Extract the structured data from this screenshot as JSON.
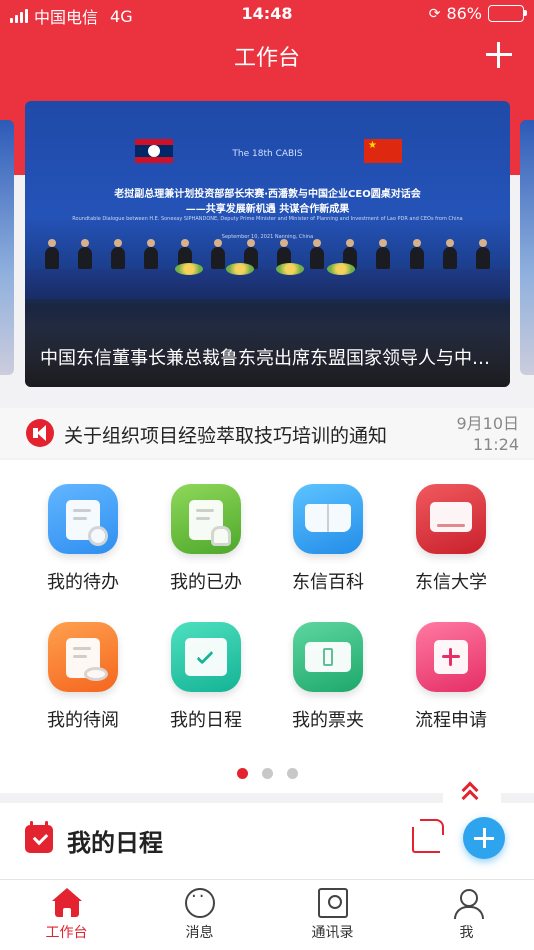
{
  "status_bar": {
    "carrier": "中国电信",
    "network": "4G",
    "time": "14:48",
    "battery": "86%"
  },
  "header": {
    "title": "工作台"
  },
  "banner": {
    "caption": "中国东信董事长兼总裁鲁东亮出席东盟国家领导人与中国企业CEO圆桌对话会",
    "image_logo": "The 18th CABIS",
    "image_headline_1": "老挝副总理兼计划投资部部长宋赛·西潘敦与中国企业CEO圆桌对话会",
    "image_headline_2": "——共享发展新机遇 共谋合作新成果",
    "image_subtext": "Roundtable Dialogue between H.E. Sonexay SIPHANDONE, Deputy Prime Minister and Minister of Planning and Investment of Lao PDR and CEOs from China",
    "image_date": "September 10, 2021  Nanning, China"
  },
  "notice": {
    "text": "关于组织项目经验萃取技巧培训的通知",
    "date": "9月10日",
    "time": "11:24"
  },
  "apps": [
    {
      "label": "我的待办",
      "icon": "todo-icon",
      "color": "#2f8ff0"
    },
    {
      "label": "我的已办",
      "icon": "done-icon",
      "color": "#64be3c"
    },
    {
      "label": "东信百科",
      "icon": "encyclopedia-icon",
      "color": "#2f9ff2"
    },
    {
      "label": "东信大学",
      "icon": "university-icon",
      "color": "#e3323c"
    },
    {
      "label": "我的待阅",
      "icon": "to-read-icon",
      "color": "#ff7a28"
    },
    {
      "label": "我的日程",
      "icon": "schedule-icon",
      "color": "#1ec5a3"
    },
    {
      "label": "我的票夹",
      "icon": "ticket-folder-icon",
      "color": "#27c07f"
    },
    {
      "label": "流程申请",
      "icon": "process-request-icon",
      "color": "#f2487a"
    }
  ],
  "pagination": {
    "total": 3,
    "active": 1
  },
  "schedule_section": {
    "title": "我的日程"
  },
  "tabbar": [
    {
      "label": "工作台",
      "icon": "home-icon",
      "active": true
    },
    {
      "label": "消息",
      "icon": "message-icon",
      "active": false
    },
    {
      "label": "通讯录",
      "icon": "contacts-icon",
      "active": false
    },
    {
      "label": "我",
      "icon": "profile-icon",
      "active": false
    }
  ],
  "colors": {
    "primary": "#eb3340",
    "accent_blue": "#2ea4ef"
  }
}
